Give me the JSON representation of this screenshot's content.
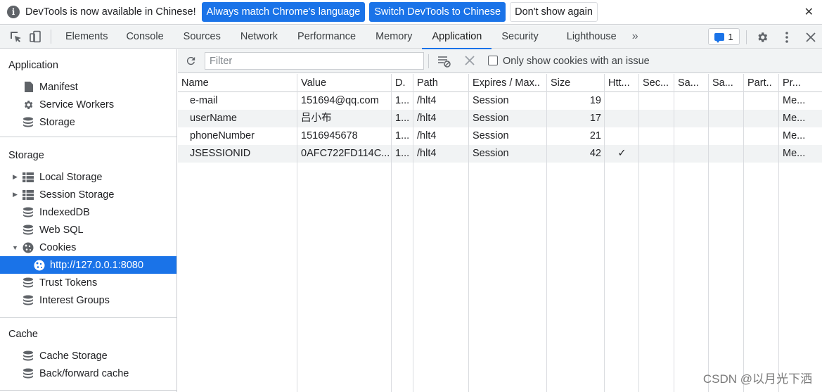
{
  "infobar": {
    "message": "DevTools is now available in Chinese!",
    "btn_match": "Always match Chrome's language",
    "btn_switch": "Switch DevTools to Chinese",
    "btn_dont_show": "Don't show again",
    "close": "✕"
  },
  "tabs": [
    {
      "label": "Elements"
    },
    {
      "label": "Console"
    },
    {
      "label": "Sources"
    },
    {
      "label": "Network"
    },
    {
      "label": "Performance"
    },
    {
      "label": "Memory"
    },
    {
      "label": "Application"
    },
    {
      "label": "Security"
    },
    {
      "label": "Lighthouse"
    }
  ],
  "tab_more": "»",
  "issues_count": "1",
  "sidebar": {
    "application_title": "Application",
    "application_items": [
      {
        "label": "Manifest",
        "icon": "file-icon"
      },
      {
        "label": "Service Workers",
        "icon": "gear-icon"
      },
      {
        "label": "Storage",
        "icon": "database-icon"
      }
    ],
    "storage_title": "Storage",
    "storage_items": [
      {
        "label": "Local Storage",
        "icon": "grid-icon"
      },
      {
        "label": "Session Storage",
        "icon": "grid-icon"
      },
      {
        "label": "IndexedDB",
        "icon": "database-icon"
      },
      {
        "label": "Web SQL",
        "icon": "database-icon"
      },
      {
        "label": "Cookies",
        "icon": "cookie-icon"
      },
      {
        "label": "http://127.0.0.1:8080",
        "icon": "cookie-icon"
      },
      {
        "label": "Trust Tokens",
        "icon": "database-icon"
      },
      {
        "label": "Interest Groups",
        "icon": "database-icon"
      }
    ],
    "cache_title": "Cache",
    "cache_items": [
      {
        "label": "Cache Storage",
        "icon": "database-icon"
      },
      {
        "label": "Back/forward cache",
        "icon": "database-icon"
      }
    ]
  },
  "toolbar": {
    "filter_placeholder": "Filter",
    "only_issue_label": "Only show cookies with an issue"
  },
  "table": {
    "columns": [
      "Name",
      "Value",
      "D.",
      "Path",
      "Expires / Max..",
      "Size",
      "Htt...",
      "Sec...",
      "Sa...",
      "Sa...",
      "Part..",
      "Pr..."
    ],
    "rows": [
      [
        "e-mail",
        "151694@qq.com",
        "1...",
        "/hlt4",
        "Session",
        "19",
        "",
        "",
        "",
        "",
        "",
        "Me..."
      ],
      [
        "userName",
        "吕小布",
        "1...",
        "/hlt4",
        "Session",
        "17",
        "",
        "",
        "",
        "",
        "",
        "Me..."
      ],
      [
        "phoneNumber",
        "1516945678",
        "1...",
        "/hlt4",
        "Session",
        "21",
        "",
        "",
        "",
        "",
        "",
        "Me..."
      ],
      [
        "JSESSIONID",
        "0AFC722FD114C...",
        "1...",
        "/hlt4",
        "Session",
        "42",
        "✓",
        "",
        "",
        "",
        "",
        "Me..."
      ]
    ]
  },
  "watermark": "CSDN @以月光下洒",
  "colors": {
    "accent": "#1a73e8",
    "toolbar_bg": "#f1f3f4",
    "border": "#cacdd1"
  }
}
